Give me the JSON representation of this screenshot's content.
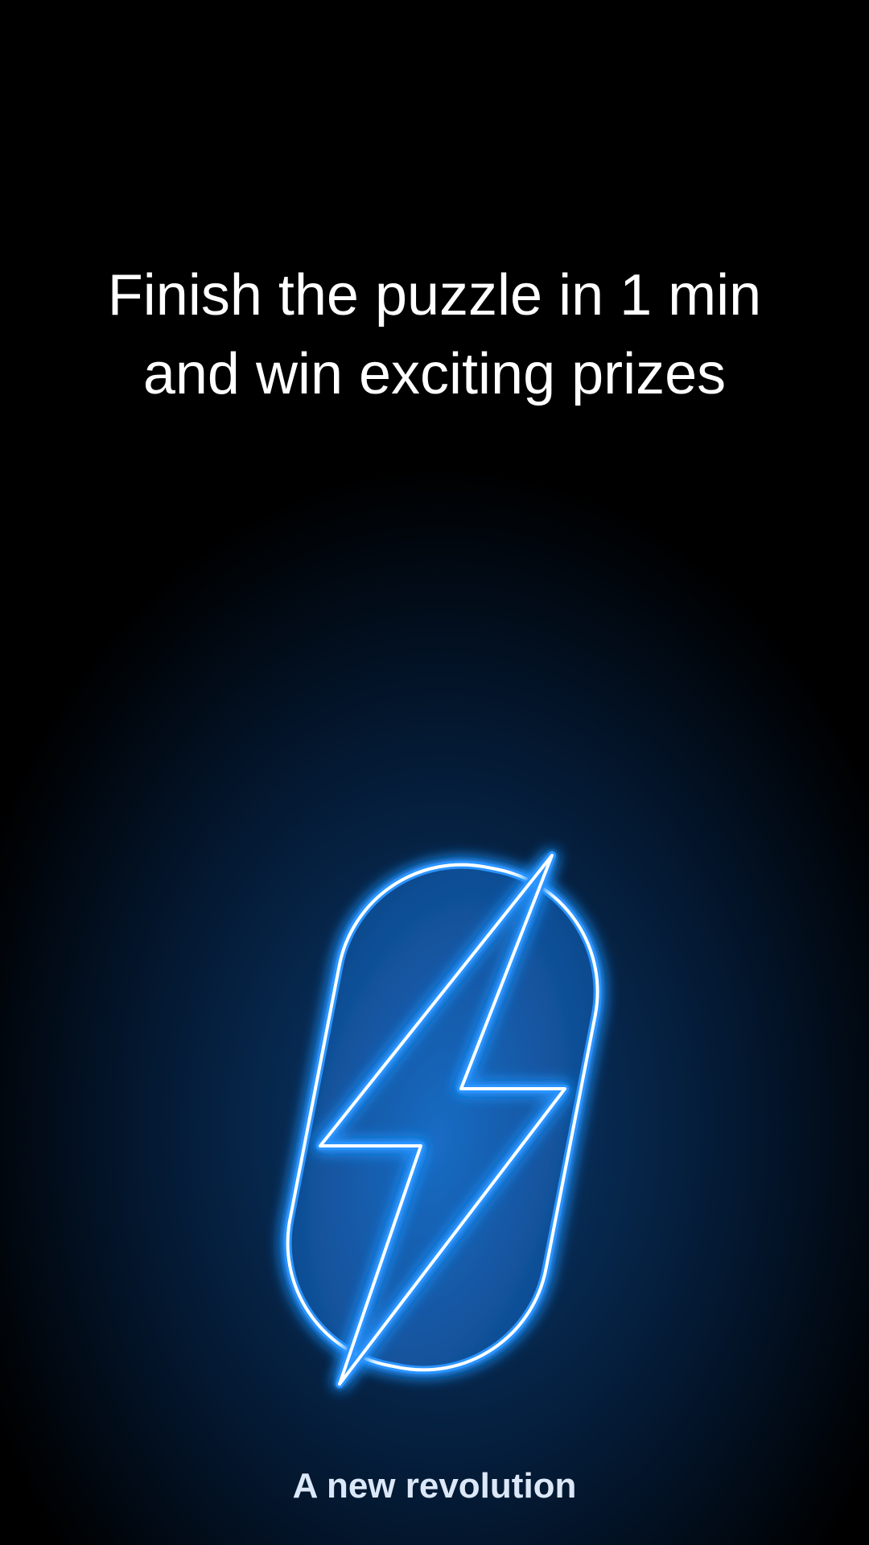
{
  "headline": {
    "line1": "Finish the puzzle in 1 min",
    "line2": "and win exciting prizes"
  },
  "logo": {
    "icon": "lightning-bolt-pill-icon",
    "stroke_color": "#ffffff",
    "glow_color": "#1e8cff",
    "fill_color": "#135aa8"
  },
  "tagline": "A new revolution",
  "colors": {
    "background": "#000000",
    "text": "#ffffff",
    "tagline": "#dce8f8"
  }
}
